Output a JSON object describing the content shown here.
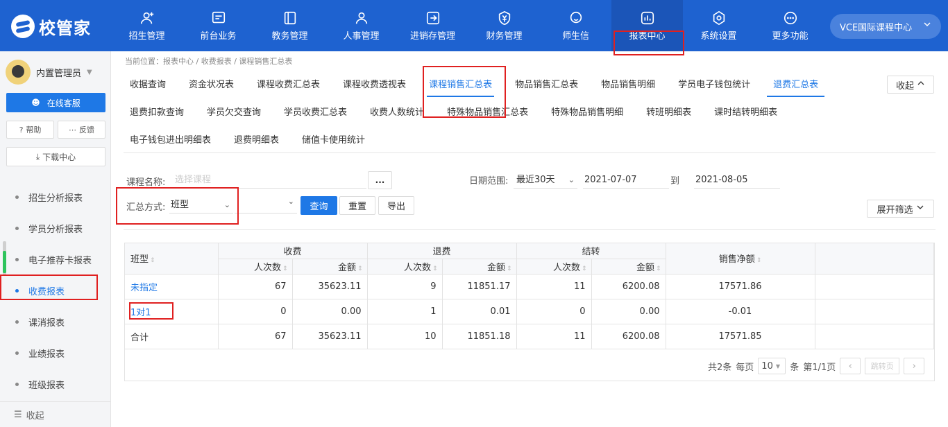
{
  "brand": {
    "name": "校管家"
  },
  "nav": [
    {
      "label": "招生管理",
      "icon": "user-plus-icon"
    },
    {
      "label": "前台业务",
      "icon": "monitor-icon"
    },
    {
      "label": "教务管理",
      "icon": "book-icon"
    },
    {
      "label": "人事管理",
      "icon": "person-icon"
    },
    {
      "label": "进销存管理",
      "icon": "login-box-icon"
    },
    {
      "label": "财务管理",
      "icon": "yen-shield-icon"
    },
    {
      "label": "师生信",
      "icon": "chat-icon"
    },
    {
      "label": "报表中心",
      "icon": "chart-icon"
    },
    {
      "label": "系统设置",
      "icon": "gear-icon"
    },
    {
      "label": "更多功能",
      "icon": "more-icon"
    }
  ],
  "campus": {
    "label": "VCE国际课程中心"
  },
  "sidebar": {
    "username": "内置管理员",
    "service": "在线客服",
    "help": "帮助",
    "feedback": "反馈",
    "download": "下载中心",
    "items": [
      "招生分析报表",
      "学员分析报表",
      "电子推荐卡报表",
      "收费报表",
      "课消报表",
      "业绩报表",
      "班级报表"
    ],
    "collapse": "收起"
  },
  "breadcrumb": "当前位置：报表中心 / 收费报表 / 课程销售汇总表",
  "tabs": {
    "row1": [
      "收据查询",
      "资金状况表",
      "课程收费汇总表",
      "课程收费透视表",
      "课程销售汇总表",
      "物品销售汇总表",
      "物品销售明细",
      "学员电子钱包统计",
      "退费汇总表"
    ],
    "row2": [
      "退费扣款查询",
      "学员欠交查询",
      "学员收费汇总表",
      "收费人数统计",
      "特殊物品销售汇总表",
      "特殊物品销售明细",
      "转班明细表",
      "课时结转明细表"
    ],
    "row3": [
      "电子钱包进出明细表",
      "退费明细表",
      "储值卡使用统计"
    ],
    "collapse": "收起"
  },
  "filters": {
    "course_label": "课程名称:",
    "course_placeholder": "选择课程",
    "dots": "...",
    "date_label": "日期范围:",
    "date_range": "最近30天",
    "date_from": "2021-07-07",
    "to": "到",
    "date_to": "2021-08-05",
    "summary_label": "汇总方式:",
    "summary_value": "班型",
    "query": "查询",
    "reset": "重置",
    "export": "导出",
    "expand": "展开筛选"
  },
  "table": {
    "col_type": "班型",
    "group_charge": "收费",
    "group_refund": "退费",
    "group_transfer": "结转",
    "col_count": "人次数",
    "col_amount": "金额",
    "col_net": "销售净额",
    "rows": [
      {
        "type": "未指定",
        "c_cnt": "67",
        "c_amt": "35623.11",
        "r_cnt": "9",
        "r_amt": "11851.17",
        "t_cnt": "11",
        "t_amt": "6200.08",
        "net": "17571.86"
      },
      {
        "type": "1对1",
        "c_cnt": "0",
        "c_amt": "0.00",
        "r_cnt": "1",
        "r_amt": "0.01",
        "t_cnt": "0",
        "t_amt": "0.00",
        "net": "-0.01"
      },
      {
        "type": "合计",
        "c_cnt": "67",
        "c_amt": "35623.11",
        "r_cnt": "10",
        "r_amt": "11851.18",
        "t_cnt": "11",
        "t_amt": "6200.08",
        "net": "17571.85"
      }
    ]
  },
  "pager": {
    "total": "共2条",
    "per_page": "每页",
    "size": "10",
    "unit": "条",
    "page": "第1/1页",
    "jump": "跳转页"
  }
}
